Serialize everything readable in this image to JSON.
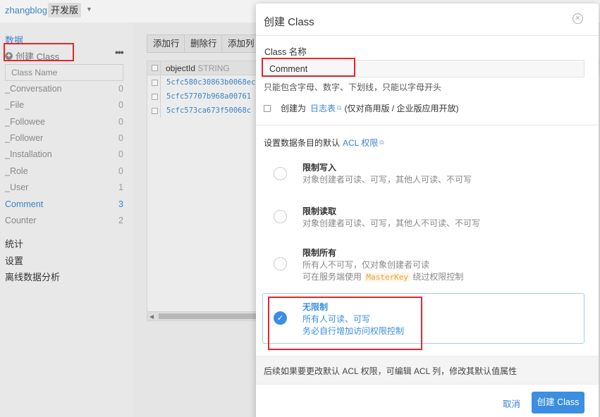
{
  "topbar": {
    "app_name": "zhangblog",
    "env": "开发版"
  },
  "sidebar": {
    "section_title": "数据",
    "create_class": "创建 Class",
    "more": "•••",
    "filter_placeholder": "Class Name",
    "classes": [
      {
        "name": "_Conversation",
        "count": "0"
      },
      {
        "name": "_File",
        "count": "0"
      },
      {
        "name": "_Followee",
        "count": "0"
      },
      {
        "name": "_Follower",
        "count": "0"
      },
      {
        "name": "_Installation",
        "count": "0"
      },
      {
        "name": "_Role",
        "count": "0"
      },
      {
        "name": "_User",
        "count": "1"
      },
      {
        "name": "Comment",
        "count": "3"
      },
      {
        "name": "Counter",
        "count": "2"
      }
    ],
    "nav": [
      "统计",
      "设置",
      "离线数据分析"
    ]
  },
  "toolbar": {
    "add_row": "添加行",
    "delete_row": "删除行",
    "add_column": "添加列"
  },
  "table": {
    "column_name": "objectId",
    "column_type": "STRING",
    "rows": [
      "5cfc580c30863b0068ec",
      "5cfc57707b968a00761",
      "5cfc573ca673f50068c"
    ]
  },
  "modal": {
    "title": "创建 Class",
    "close": "×",
    "name_label": "Class 名称",
    "name_value": "Comment",
    "name_hint": "只能包含字母、数字、下划线，只能以字母开头",
    "log_prefix": "创建为",
    "log_link": "日志表",
    "log_suffix": "(仅对商用版 / 企业版应用开放)",
    "acl_prefix": "设置数据条目的默认",
    "acl_link": "ACL 权限",
    "options": [
      {
        "title": "限制写入",
        "line1": "对象创建者可读、可写，其他人可读、不可写"
      },
      {
        "title": "限制读取",
        "line1": "对象创建者可读、可写，其他人不可读、不可写"
      },
      {
        "title": "限制所有",
        "line1": "所有人不可写，仅对象创建者可读",
        "line2_prefix": "可在服务端使用",
        "line2_code": "MasterKey",
        "line2_suffix": "绕过权限控制"
      },
      {
        "title": "无限制",
        "line1": "所有人可读、可写",
        "line2": "务必自行增加访问权限控制"
      }
    ],
    "selected_option": 3,
    "footer_note": "后续如果要更改默认 ACL 权限，可编辑 ACL 列，修改其默认值属性",
    "cancel": "取消",
    "submit": "创建 Class"
  },
  "colors": {
    "accent": "#3b8ee0",
    "highlight": "#e3262c"
  }
}
